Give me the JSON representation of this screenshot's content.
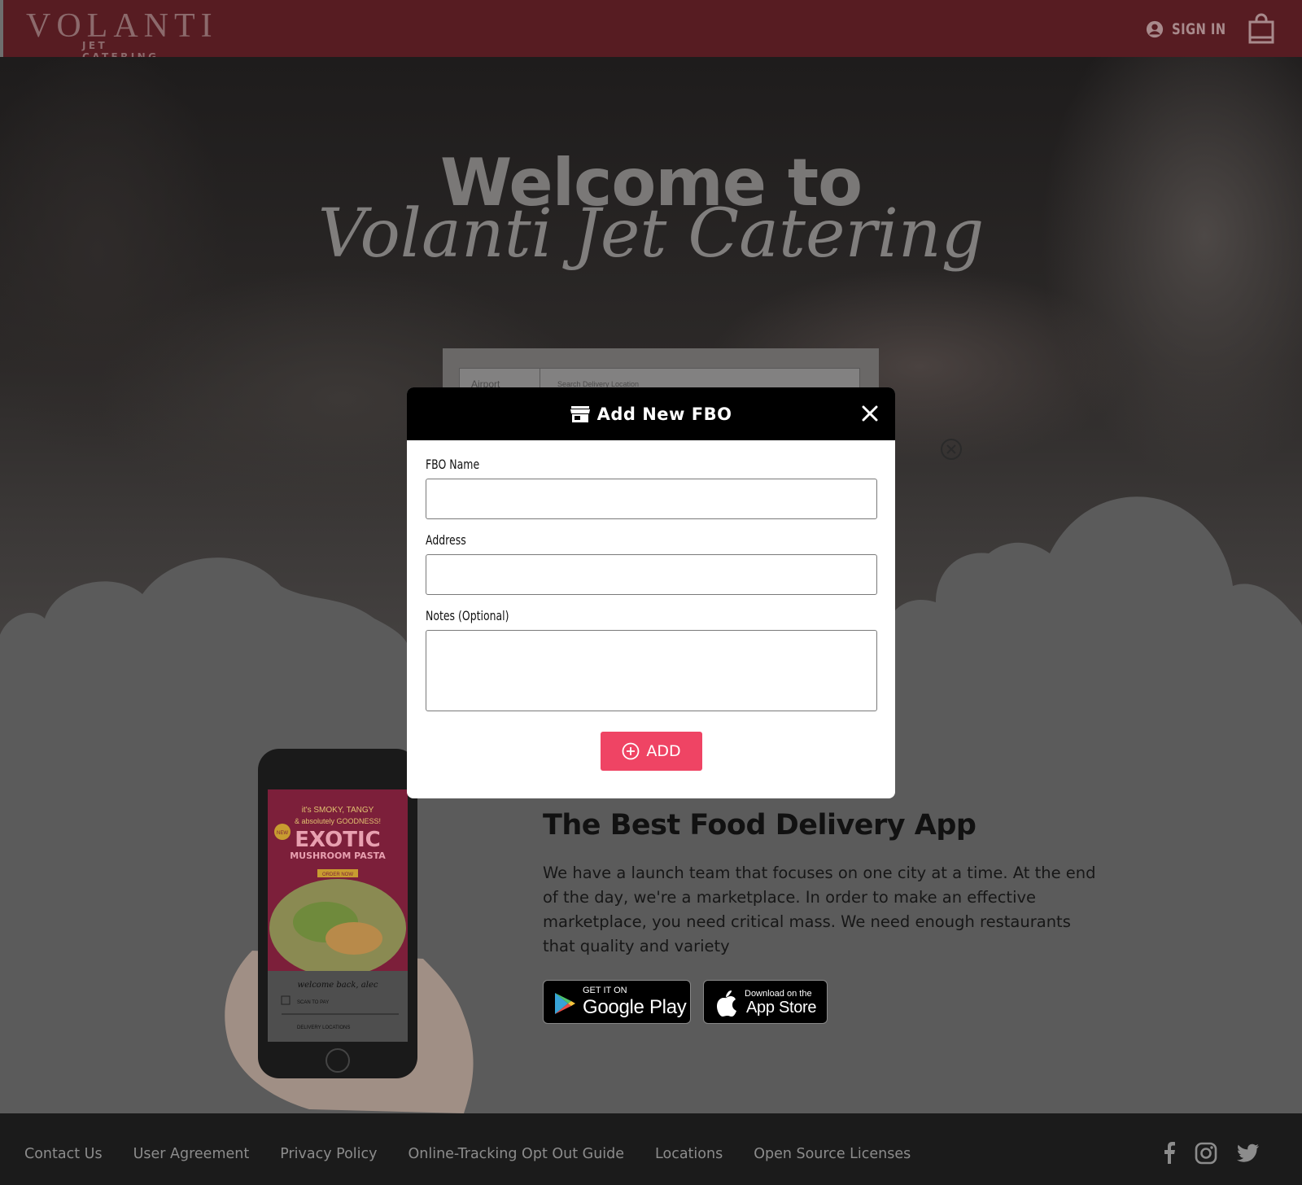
{
  "header": {
    "logo_main": "VOLANTI",
    "logo_sub": "JET CATERING",
    "signin_label": "SIGN IN",
    "signin_icon": "user-circle-icon",
    "cart_icon": "shopping-bag-icon"
  },
  "hero": {
    "title": "Welcome to",
    "script_title": "Volanti Jet Catering",
    "search": {
      "segment_label": "Airport",
      "placeholder": "Search Delivery Location"
    }
  },
  "modal": {
    "title": "Add New FBO",
    "title_icon": "store-icon",
    "fields": {
      "fbo_name_label": "FBO Name",
      "fbo_name_value": "",
      "address_label": "Address",
      "address_value": "",
      "notes_label": "Notes (Optional)",
      "notes_value": ""
    },
    "add_label": "ADD",
    "add_icon": "plus-circle-icon",
    "close_icon": "close-icon"
  },
  "promo": {
    "title": "The Best Food Delivery App",
    "text": "We have a launch team that focuses on one city at a time. At the end of the day, we're a marketplace. In order to make an effective marketplace, you need critical mass. We need enough restaurants that quality and variety",
    "google_small": "GET IT ON",
    "google_big": "Google Play",
    "apple_small": "Download on the",
    "apple_big": "App Store",
    "phone_screen": {
      "line1": "it's SMOKY, TANGY",
      "line2": "& absolutely GOODNESS!",
      "headline": "EXOTIC",
      "subheadline": "MUSHROOM PASTA",
      "cta": "ORDER NOW",
      "greeting": "welcome back, alec",
      "menu1": "SCAN TO PAY",
      "menu2": "DELIVERY LOCATIONS",
      "badge": "NEW"
    }
  },
  "footer": {
    "links": [
      "Contact Us",
      "User Agreement",
      "Privacy Policy",
      "Online-Tracking Opt Out Guide",
      "Locations",
      "Open Source Licenses"
    ],
    "social_icons": [
      "facebook-icon",
      "instagram-icon",
      "twitter-icon"
    ]
  },
  "colors": {
    "header_bg": "#571c22",
    "accent": "#ef4464",
    "footer_bg": "#1b1b1b",
    "overlay": "#5b5b5b"
  }
}
